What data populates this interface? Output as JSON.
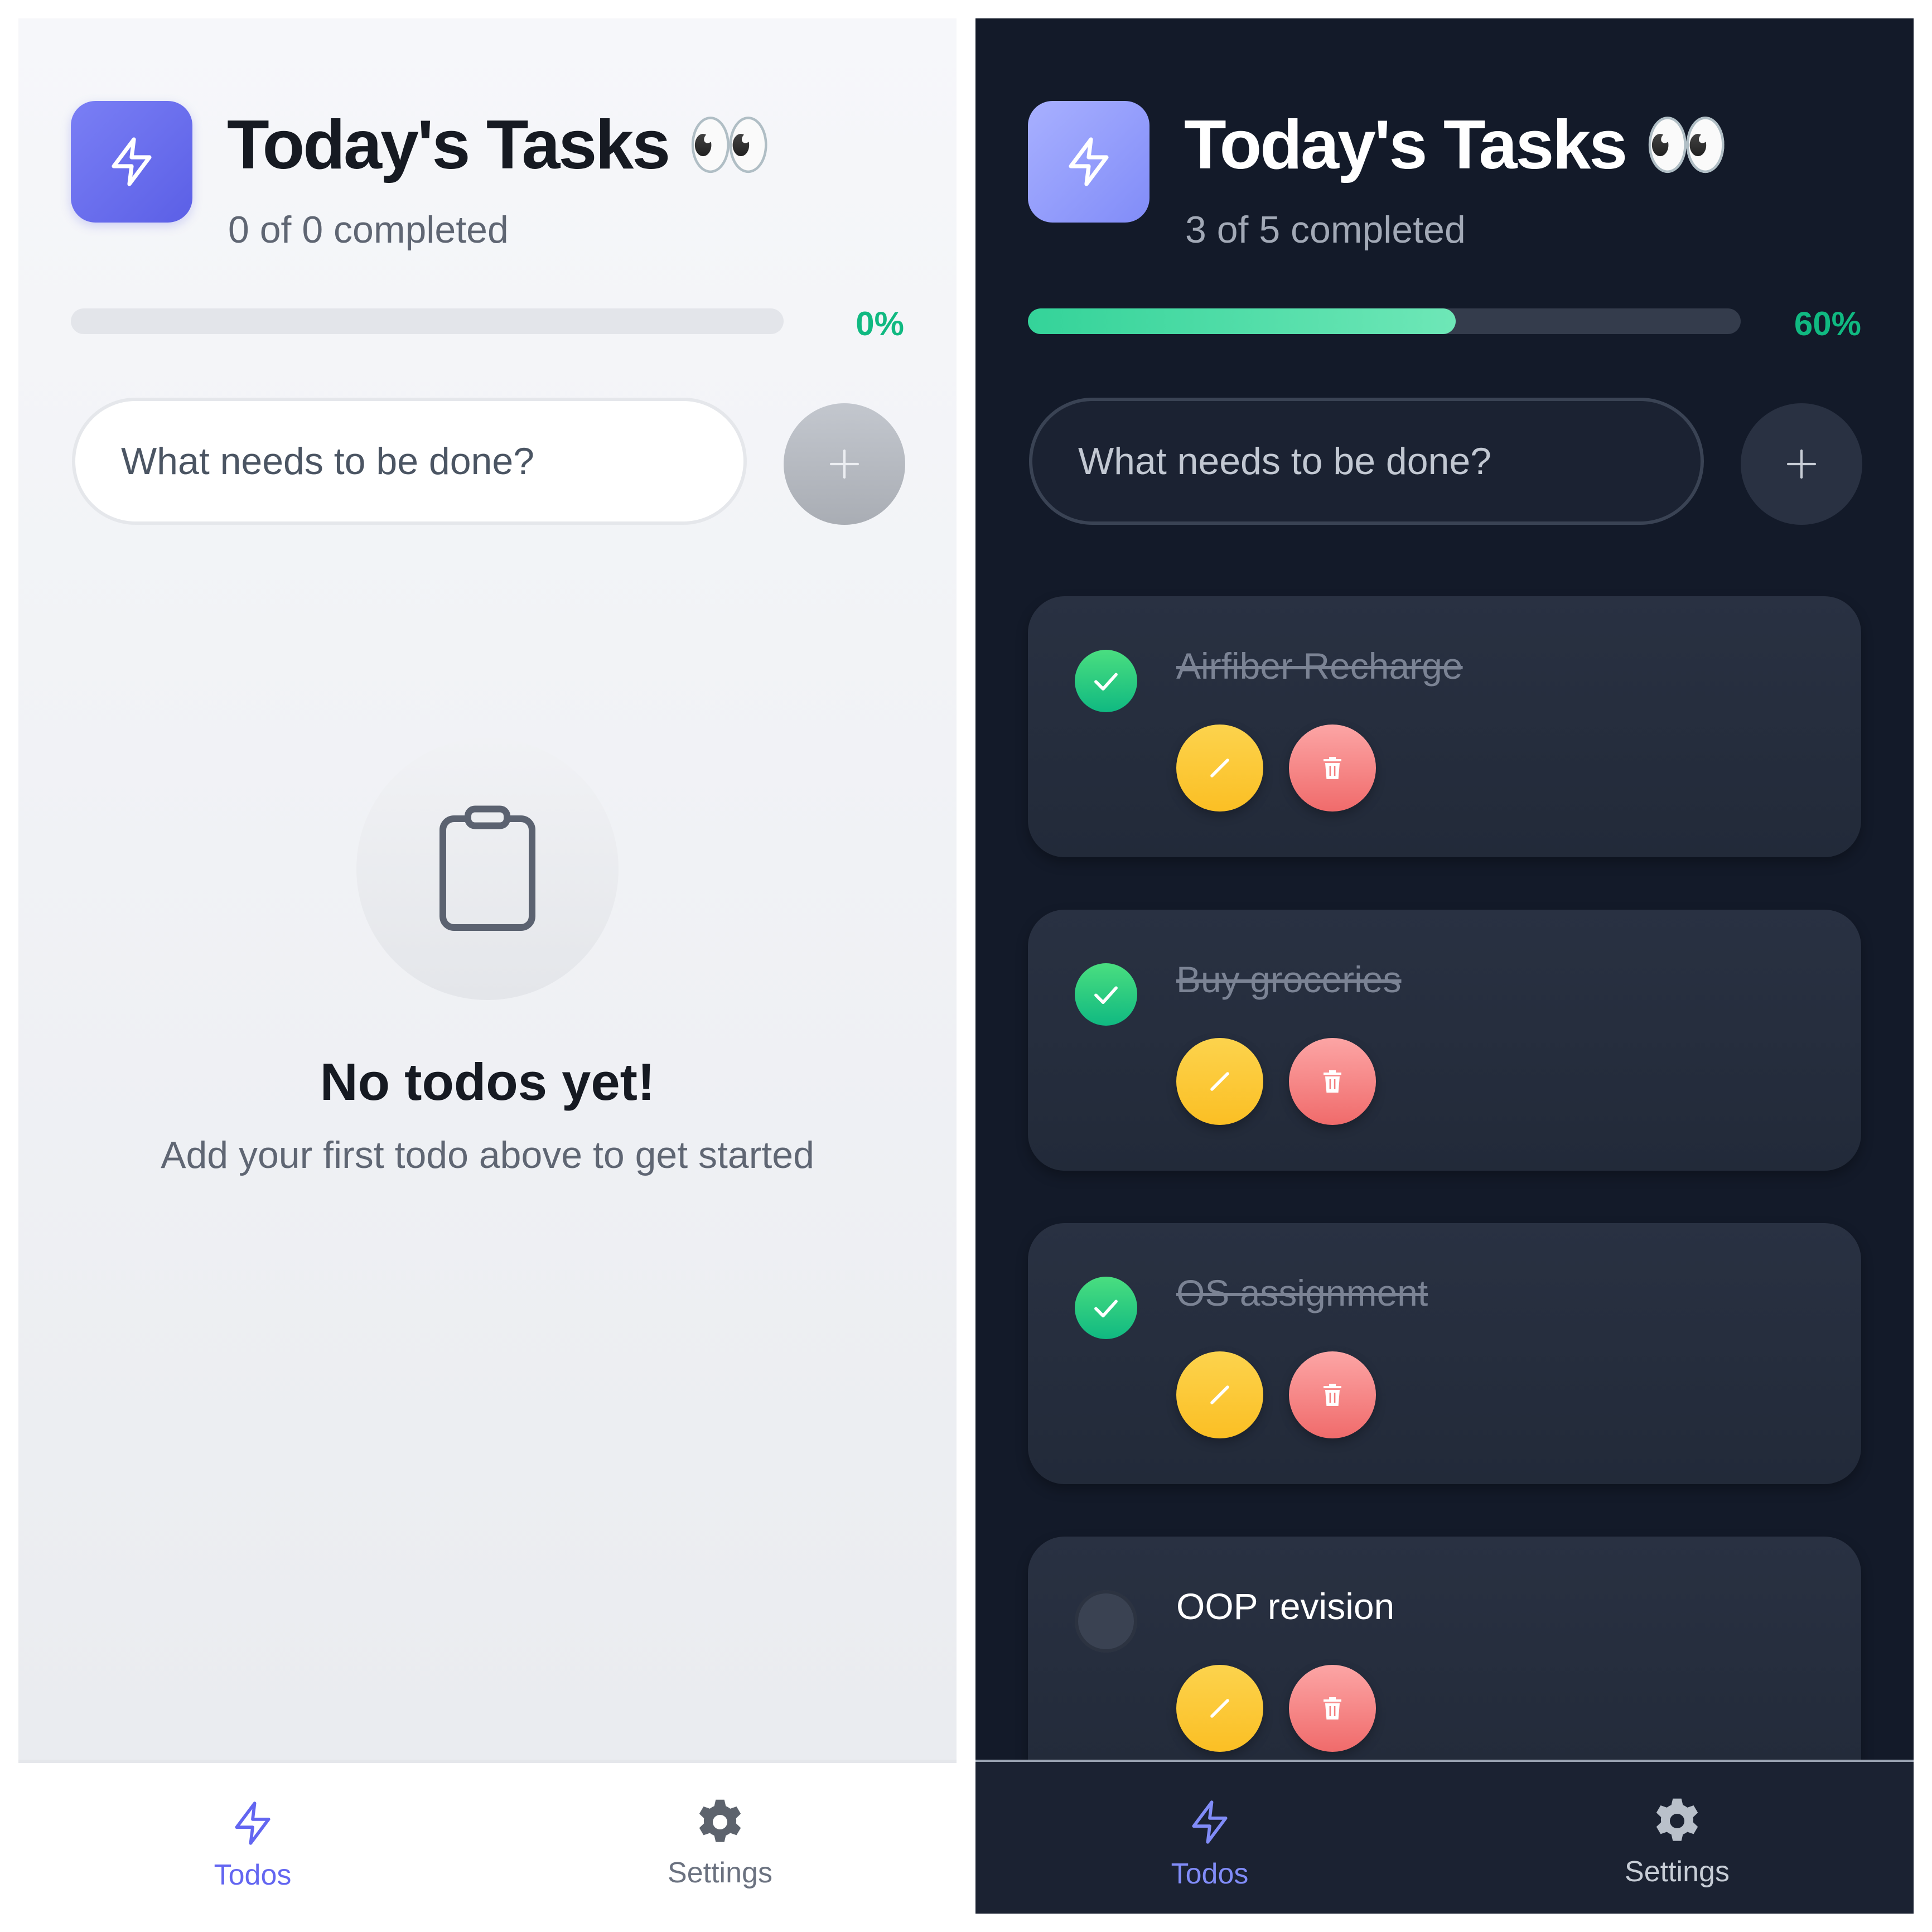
{
  "colors": {
    "accent": "#6366f1",
    "success": "#10b981",
    "edit": "#fbbf24",
    "delete": "#f87171",
    "dark_bg": "#131a29",
    "light_bg": "#f3f4f6"
  },
  "light": {
    "header": {
      "title": "Today's Tasks 👀",
      "subtitle": "0 of 0 completed",
      "icon": "lightning-bolt-icon"
    },
    "progress": {
      "value": 0,
      "label": "0%"
    },
    "input": {
      "placeholder": "What needs to be done?",
      "add_icon": "plus-icon"
    },
    "empty_state": {
      "icon": "clipboard-icon",
      "title": "No todos yet!",
      "subtitle": "Add your first todo above to get started"
    },
    "nav": {
      "items": [
        {
          "label": "Todos",
          "icon": "lightning-bolt-icon",
          "active": true
        },
        {
          "label": "Settings",
          "icon": "gear-icon",
          "active": false
        }
      ]
    }
  },
  "dark": {
    "header": {
      "title": "Today's Tasks 👀",
      "subtitle": "3 of 5 completed",
      "icon": "lightning-bolt-icon"
    },
    "progress": {
      "value": 0.6,
      "label": "60%"
    },
    "input": {
      "placeholder": "What needs to be done?",
      "add_icon": "plus-icon"
    },
    "todos": [
      {
        "text": "Airfiber Recharge",
        "completed": true
      },
      {
        "text": "Buy groceries",
        "completed": true
      },
      {
        "text": "OS assignment",
        "completed": true
      },
      {
        "text": "OOP revision",
        "completed": false
      }
    ],
    "nav": {
      "items": [
        {
          "label": "Todos",
          "icon": "lightning-bolt-icon",
          "active": true
        },
        {
          "label": "Settings",
          "icon": "gear-icon",
          "active": false
        }
      ]
    }
  }
}
